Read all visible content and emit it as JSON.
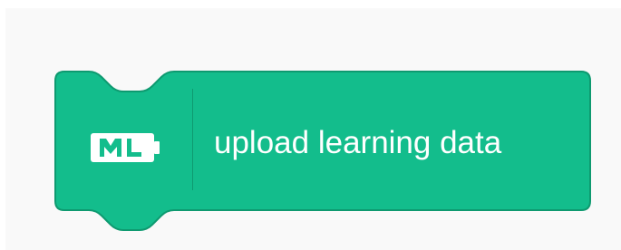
{
  "block": {
    "label": "upload learning data",
    "icon": {
      "name": "ml-icon",
      "text": "ML"
    },
    "colors": {
      "fill": "#13bd8c",
      "stroke": "#0e9a70",
      "text": "#ffffff",
      "workspace": "#f9f9f9"
    }
  }
}
